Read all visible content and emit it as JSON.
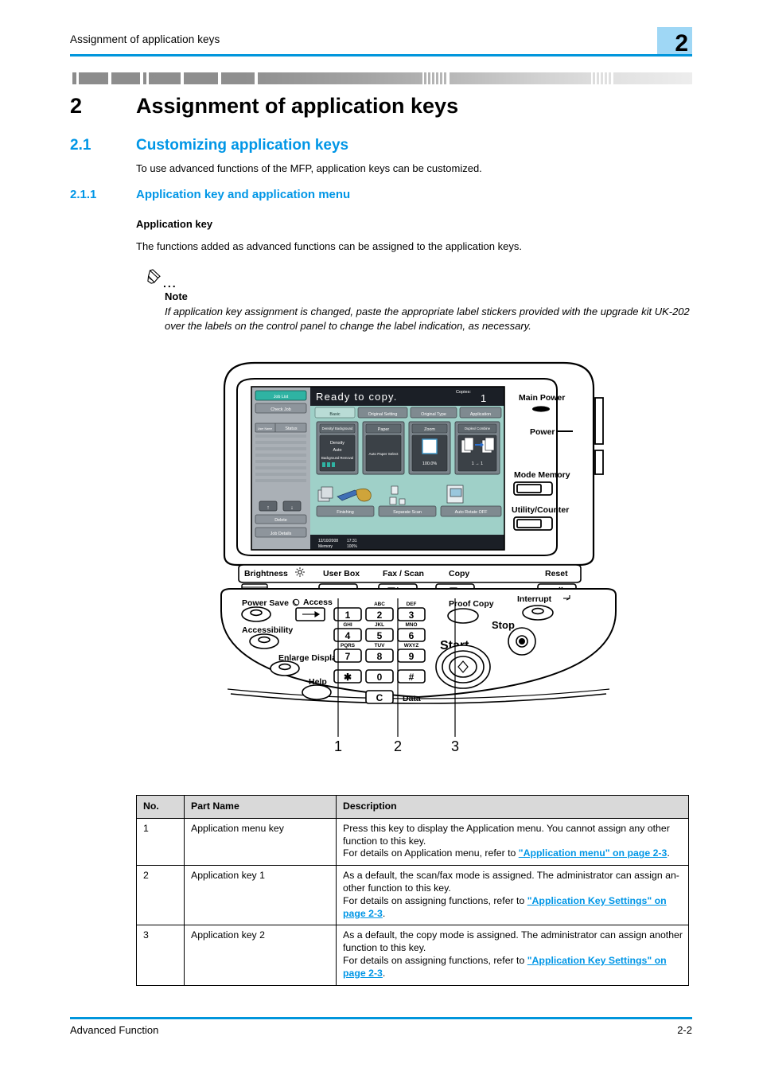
{
  "header": {
    "running_title": "Assignment of application keys",
    "chapter_badge": "2"
  },
  "chapter": {
    "number": "2",
    "title": "Assignment of application keys"
  },
  "section": {
    "number": "2.1",
    "title": "Customizing application keys",
    "intro": "To use advanced functions of the MFP, application keys can be customized."
  },
  "subsection": {
    "number": "2.1.1",
    "title": "Application key and application menu",
    "heading": "Application key",
    "body": "The functions added as advanced functions can be assigned to the application keys."
  },
  "note": {
    "icon": "pencil-icon",
    "dots": "...",
    "label": "Note",
    "text": "If application key assignment is changed, paste the appropriate label stickers provided with the upgrade kit UK-202 over the labels on the control panel to change the label indication, as necessary."
  },
  "illustration": {
    "lcd": {
      "status_message": "Ready to copy.",
      "copies_label": "Copies:",
      "copies_value": "1",
      "left_buttons": [
        "Job List",
        "Check Job"
      ],
      "list_headers": [
        "User Name",
        "Status"
      ],
      "list_actions": [
        "Delete",
        "Job Details"
      ],
      "arrow_up": "↑",
      "arrow_down": "↓",
      "tabs": [
        "Basic",
        "Original Setting",
        "Original Type",
        "Application"
      ],
      "cards": [
        {
          "title": "Density/ Background",
          "lines": [
            "Density",
            "Auto",
            "Background Removal"
          ]
        },
        {
          "title": "Paper",
          "lines": [
            "Auto Paper Select"
          ]
        },
        {
          "title": "Zoom",
          "lines": [
            "100.0%"
          ]
        },
        {
          "title": "Duplex/ Combine",
          "lines": [
            "1 → 1"
          ]
        }
      ],
      "bottom_buttons": [
        "Finishing",
        "Separate Scan",
        "Auto Rotate OFF"
      ],
      "status_bar": {
        "date": "12/10/2008",
        "time": "17:31",
        "memory_label": "Memory",
        "memory_value": "100%"
      }
    },
    "right_panel": {
      "main_power_label": "Main Power",
      "power_label": "Power",
      "mode_memory_label": "Mode Memory",
      "utility_counter_label": "Utility/Counter"
    },
    "key_strip": {
      "brightness_label": "Brightness",
      "user_box_label": "User Box",
      "fax_scan_label": "Fax / Scan",
      "copy_label": "Copy",
      "reset_label": "Reset"
    },
    "left_keys": [
      "Power Save",
      "Accessibility",
      "Enlarge Display",
      "Help"
    ],
    "access_label": "Access",
    "keypad": {
      "keys": [
        "1",
        "2",
        "3",
        "4",
        "5",
        "6",
        "7",
        "8",
        "9",
        "✱",
        "0",
        "#"
      ],
      "letters": [
        "",
        "ABC",
        "DEF",
        "GHI",
        "JKL",
        "MNO",
        "PQRS",
        "TUV",
        "WXYZ"
      ],
      "clear_key": "C",
      "data_label": "Data"
    },
    "right_keys": {
      "proof_copy": "Proof Copy",
      "interrupt": "Interrupt",
      "stop": "Stop",
      "start": "Start"
    },
    "callouts": [
      "1",
      "2",
      "3"
    ]
  },
  "table": {
    "headers": [
      "No.",
      "Part Name",
      "Description"
    ],
    "rows": [
      {
        "no": "1",
        "name": "Application menu key",
        "desc_pre": "Press this key to display the Application menu. You cannot assign any other function to this key.",
        "desc_ref_pre": "For details on Application menu, refer to ",
        "desc_link": "\"Application menu\" on page 2-3",
        "desc_tail": "."
      },
      {
        "no": "2",
        "name": "Application key 1",
        "desc_pre": "As a default, the scan/fax mode is assigned. The administrator can assign an-other function to this key.",
        "desc_ref_pre": "For details on assigning functions, refer to ",
        "desc_link": "\"Application Key Settings\" on page 2-3",
        "desc_tail": "."
      },
      {
        "no": "3",
        "name": "Application key 2",
        "desc_pre": "As a default, the copy mode is assigned. The administrator can assign another function to this key.",
        "desc_ref_pre": "For details on assigning functions, refer to ",
        "desc_link": "\"Application Key Settings\" on page 2-3",
        "desc_tail": "."
      }
    ]
  },
  "footer": {
    "left": "Advanced Function",
    "right": "2-2"
  },
  "colors": {
    "accent_blue": "#0096e6",
    "badge_blue": "#9fd7f5",
    "lcd_teal": "#9fd0c8",
    "lcd_dark": "#2b3038"
  }
}
